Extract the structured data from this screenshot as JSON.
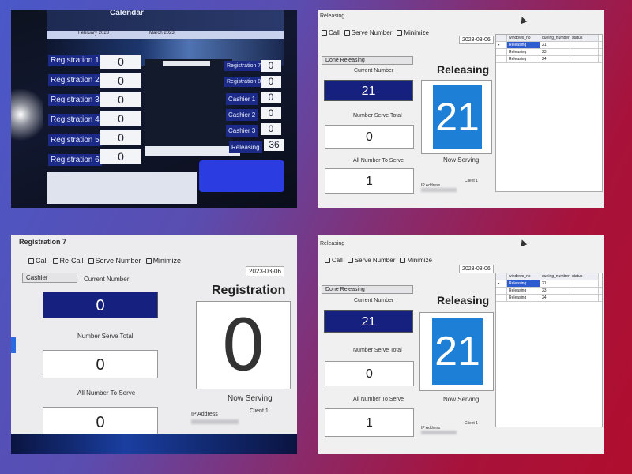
{
  "colors": {
    "dark_navy": "#16207e",
    "serving_blue": "#1e7fd6",
    "label_blue": "#1b2a86"
  },
  "photo1": {
    "header_title": "Calendar",
    "months": [
      "February 2023",
      "March 2023"
    ],
    "left_counters": [
      {
        "label": "Registration 1",
        "value": "0"
      },
      {
        "label": "Registration 2",
        "value": "0"
      },
      {
        "label": "Registration 3",
        "value": "0"
      },
      {
        "label": "Registration 4",
        "value": "0"
      },
      {
        "label": "Registration 5",
        "value": "0"
      },
      {
        "label": "Registration 6",
        "value": "0"
      }
    ],
    "right_counters": [
      {
        "label": "Registration 7",
        "value": "0"
      },
      {
        "label": "Registration 8",
        "value": "0"
      },
      {
        "label": "Cashier 1",
        "value": "0"
      },
      {
        "label": "Cashier 2",
        "value": "0"
      },
      {
        "label": "Cashier 3",
        "value": "0"
      },
      {
        "label": "Releasing",
        "value": "36"
      }
    ]
  },
  "photo2": {
    "window_title": "Releasing",
    "toolbar": {
      "call": "Call",
      "serve_number": "Serve Number",
      "minimize": "Minimize"
    },
    "date": "2023-03-06",
    "dropdown": "Done Releasing",
    "current_number_label": "Current Number",
    "current_number": "21",
    "number_serve_total_label": "Number Serve Total",
    "number_serve_total": "0",
    "all_number_label": "All Number To Serve",
    "all_number": "1",
    "big_title": "Releasing",
    "now_serving_number": "21",
    "now_serving_label": "Now Serving",
    "ip_label": "IP Address",
    "client_label": "Client 1",
    "grid": {
      "headers": [
        "windows_no",
        "queing_number",
        "status"
      ],
      "rows": [
        [
          "Releasing",
          "21",
          ""
        ],
        [
          "Releasing",
          "23",
          ""
        ],
        [
          "Releasing",
          "24",
          ""
        ]
      ]
    }
  },
  "photo3": {
    "window_title": "Registration 7",
    "toolbar": {
      "call": "Call",
      "recall": "Re-Call",
      "serve_number": "Serve Number",
      "minimize": "Minimize"
    },
    "date": "2023-03-06",
    "dropdown": "Cashier",
    "current_number_label": "Current Number",
    "current_number": "0",
    "number_serve_total_label": "Number Serve Total",
    "number_serve_total": "0",
    "all_number_label": "All Number To Serve",
    "all_number": "0",
    "big_title": "Registration",
    "now_serving_number": "0",
    "now_serving_label": "Now Serving",
    "ip_label": "IP Address",
    "client_label": "Client 1"
  },
  "photo4": {
    "window_title": "Releasing",
    "toolbar": {
      "call": "Call",
      "serve_number": "Serve Number",
      "minimize": "Minimize"
    },
    "date": "2023-03-06",
    "dropdown": "Done Releasing",
    "current_number_label": "Current Number",
    "current_number": "21",
    "number_serve_total_label": "Number Serve Total",
    "number_serve_total": "0",
    "all_number_label": "All Number To Serve",
    "all_number": "1",
    "big_title": "Releasing",
    "now_serving_number": "21",
    "now_serving_label": "Now Serving",
    "ip_label": "IP Address",
    "client_label": "Client 1",
    "grid": {
      "headers": [
        "windows_no",
        "queing_number",
        "status"
      ],
      "rows": [
        [
          "Releasing",
          "21",
          ""
        ],
        [
          "Releasing",
          "23",
          ""
        ],
        [
          "Releasing",
          "24",
          ""
        ]
      ]
    }
  }
}
